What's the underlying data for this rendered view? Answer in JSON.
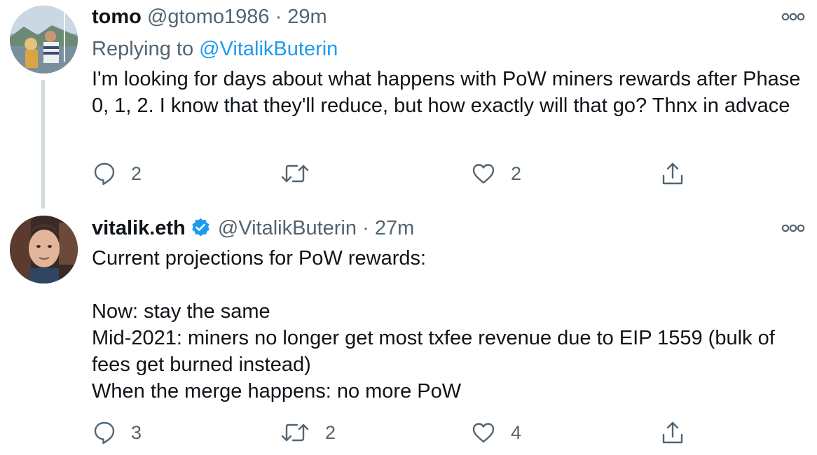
{
  "tweets": [
    {
      "display_name": "tomo",
      "handle": "@gtomo1986",
      "separator": "·",
      "time": "29m",
      "replying_prefix": "Replying to",
      "replying_to": "@VitalikButerin",
      "text": "I'm looking for days about what happens with PoW miners rewards after Phase 0, 1, 2. I know that they'll reduce, but how exactly will that go? Thnx in advace",
      "verified": false,
      "actions": {
        "reply_count": "2",
        "retweet_count": "",
        "like_count": "2"
      }
    },
    {
      "display_name": "vitalik.eth",
      "handle": "@VitalikButerin",
      "separator": "·",
      "time": "27m",
      "text": "Current projections for PoW rewards:\n\nNow: stay the same\nMid-2021: miners no longer get most txfee revenue due to EIP 1559 (bulk of fees get burned instead)\nWhen the merge happens: no more PoW",
      "verified": true,
      "actions": {
        "reply_count": "3",
        "retweet_count": "2",
        "like_count": "4"
      }
    }
  ],
  "icons": {
    "reply": "reply-icon",
    "retweet": "retweet-icon",
    "like": "heart-icon",
    "share": "share-icon",
    "more": "more-icon",
    "verified": "verified-badge-icon"
  },
  "colors": {
    "text": "#0f1419",
    "secondary": "#536471",
    "link": "#1d9bf0",
    "thread_line": "#cfd9de"
  }
}
